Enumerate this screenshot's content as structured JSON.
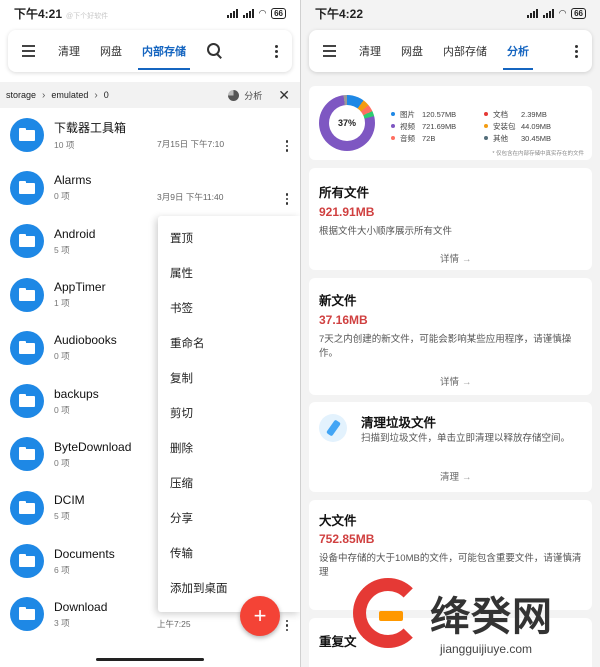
{
  "left": {
    "status": {
      "time": "下午4:21",
      "subtitle": "@下个好软件",
      "battery": "66"
    },
    "tabs": [
      "清理",
      "网盘",
      "内部存储"
    ],
    "active_tab": "内部存储",
    "breadcrumb": {
      "parts": [
        "storage",
        "emulated",
        "0"
      ],
      "analyze": "分析"
    },
    "files": [
      {
        "name": "下载器工具箱",
        "count": "10 项",
        "date": "7月15日 下午7:10"
      },
      {
        "name": "Alarms",
        "count": "0 项",
        "date": "3月9日 下午11:40"
      },
      {
        "name": "Android",
        "count": "5 项",
        "date": ""
      },
      {
        "name": "AppTimer",
        "count": "1 项",
        "date": ""
      },
      {
        "name": "Audiobooks",
        "count": "0 项",
        "date": ""
      },
      {
        "name": "backups",
        "count": "0 项",
        "date": ""
      },
      {
        "name": "ByteDownload",
        "count": "0 项",
        "date": ""
      },
      {
        "name": "DCIM",
        "count": "5 项",
        "date": ""
      },
      {
        "name": "Documents",
        "count": "6 项",
        "date": ""
      },
      {
        "name": "Download",
        "count": "3 项",
        "date": "上午7:25"
      }
    ],
    "context_menu": [
      "置顶",
      "属性",
      "书签",
      "重命名",
      "复制",
      "剪切",
      "删除",
      "压缩",
      "分享",
      "传输",
      "添加到桌面"
    ],
    "fab": "+"
  },
  "right": {
    "status": {
      "time": "下午4:22",
      "battery": "66"
    },
    "tabs": [
      "清理",
      "网盘",
      "内部存储",
      "分析"
    ],
    "active_tab": "分析",
    "storage": {
      "percent": "37%",
      "legend": [
        {
          "label": "图片",
          "value": "120.57MB",
          "color": "#1e88e5"
        },
        {
          "label": "视频",
          "value": "721.69MB",
          "color": "#7e57c2"
        },
        {
          "label": "音频",
          "value": "72B",
          "color": "#ff6f61"
        },
        {
          "label": "文档",
          "value": "2.39MB",
          "color": "#e53935"
        },
        {
          "label": "安装包",
          "value": "44.09MB",
          "color": "#f39c12"
        },
        {
          "label": "其他",
          "value": "30.45MB",
          "color": "#546e7a"
        }
      ],
      "note": "* 仅包含在内部存储中真实存在的文件"
    },
    "cards": [
      {
        "title": "所有文件",
        "size": "921.91MB",
        "desc": "根据文件大小顺序展示所有文件",
        "action": "详情"
      },
      {
        "title": "新文件",
        "size": "37.16MB",
        "desc": "7天之内创建的新文件，可能会影响某些应用程序，请谨慎操作。",
        "action": "详情"
      },
      {
        "title": "清理垃圾文件",
        "desc": "扫描到垃圾文件，单击立即清理以释放存储空间。",
        "action": "清理"
      },
      {
        "title": "大文件",
        "size": "752.85MB",
        "desc": "设备中存储的大于10MB的文件，可能包含重要文件，请谨慎清理"
      },
      {
        "title": "重复文"
      }
    ]
  },
  "watermark": {
    "text": "绛癸网",
    "url": "jiangguijiuye.com"
  }
}
